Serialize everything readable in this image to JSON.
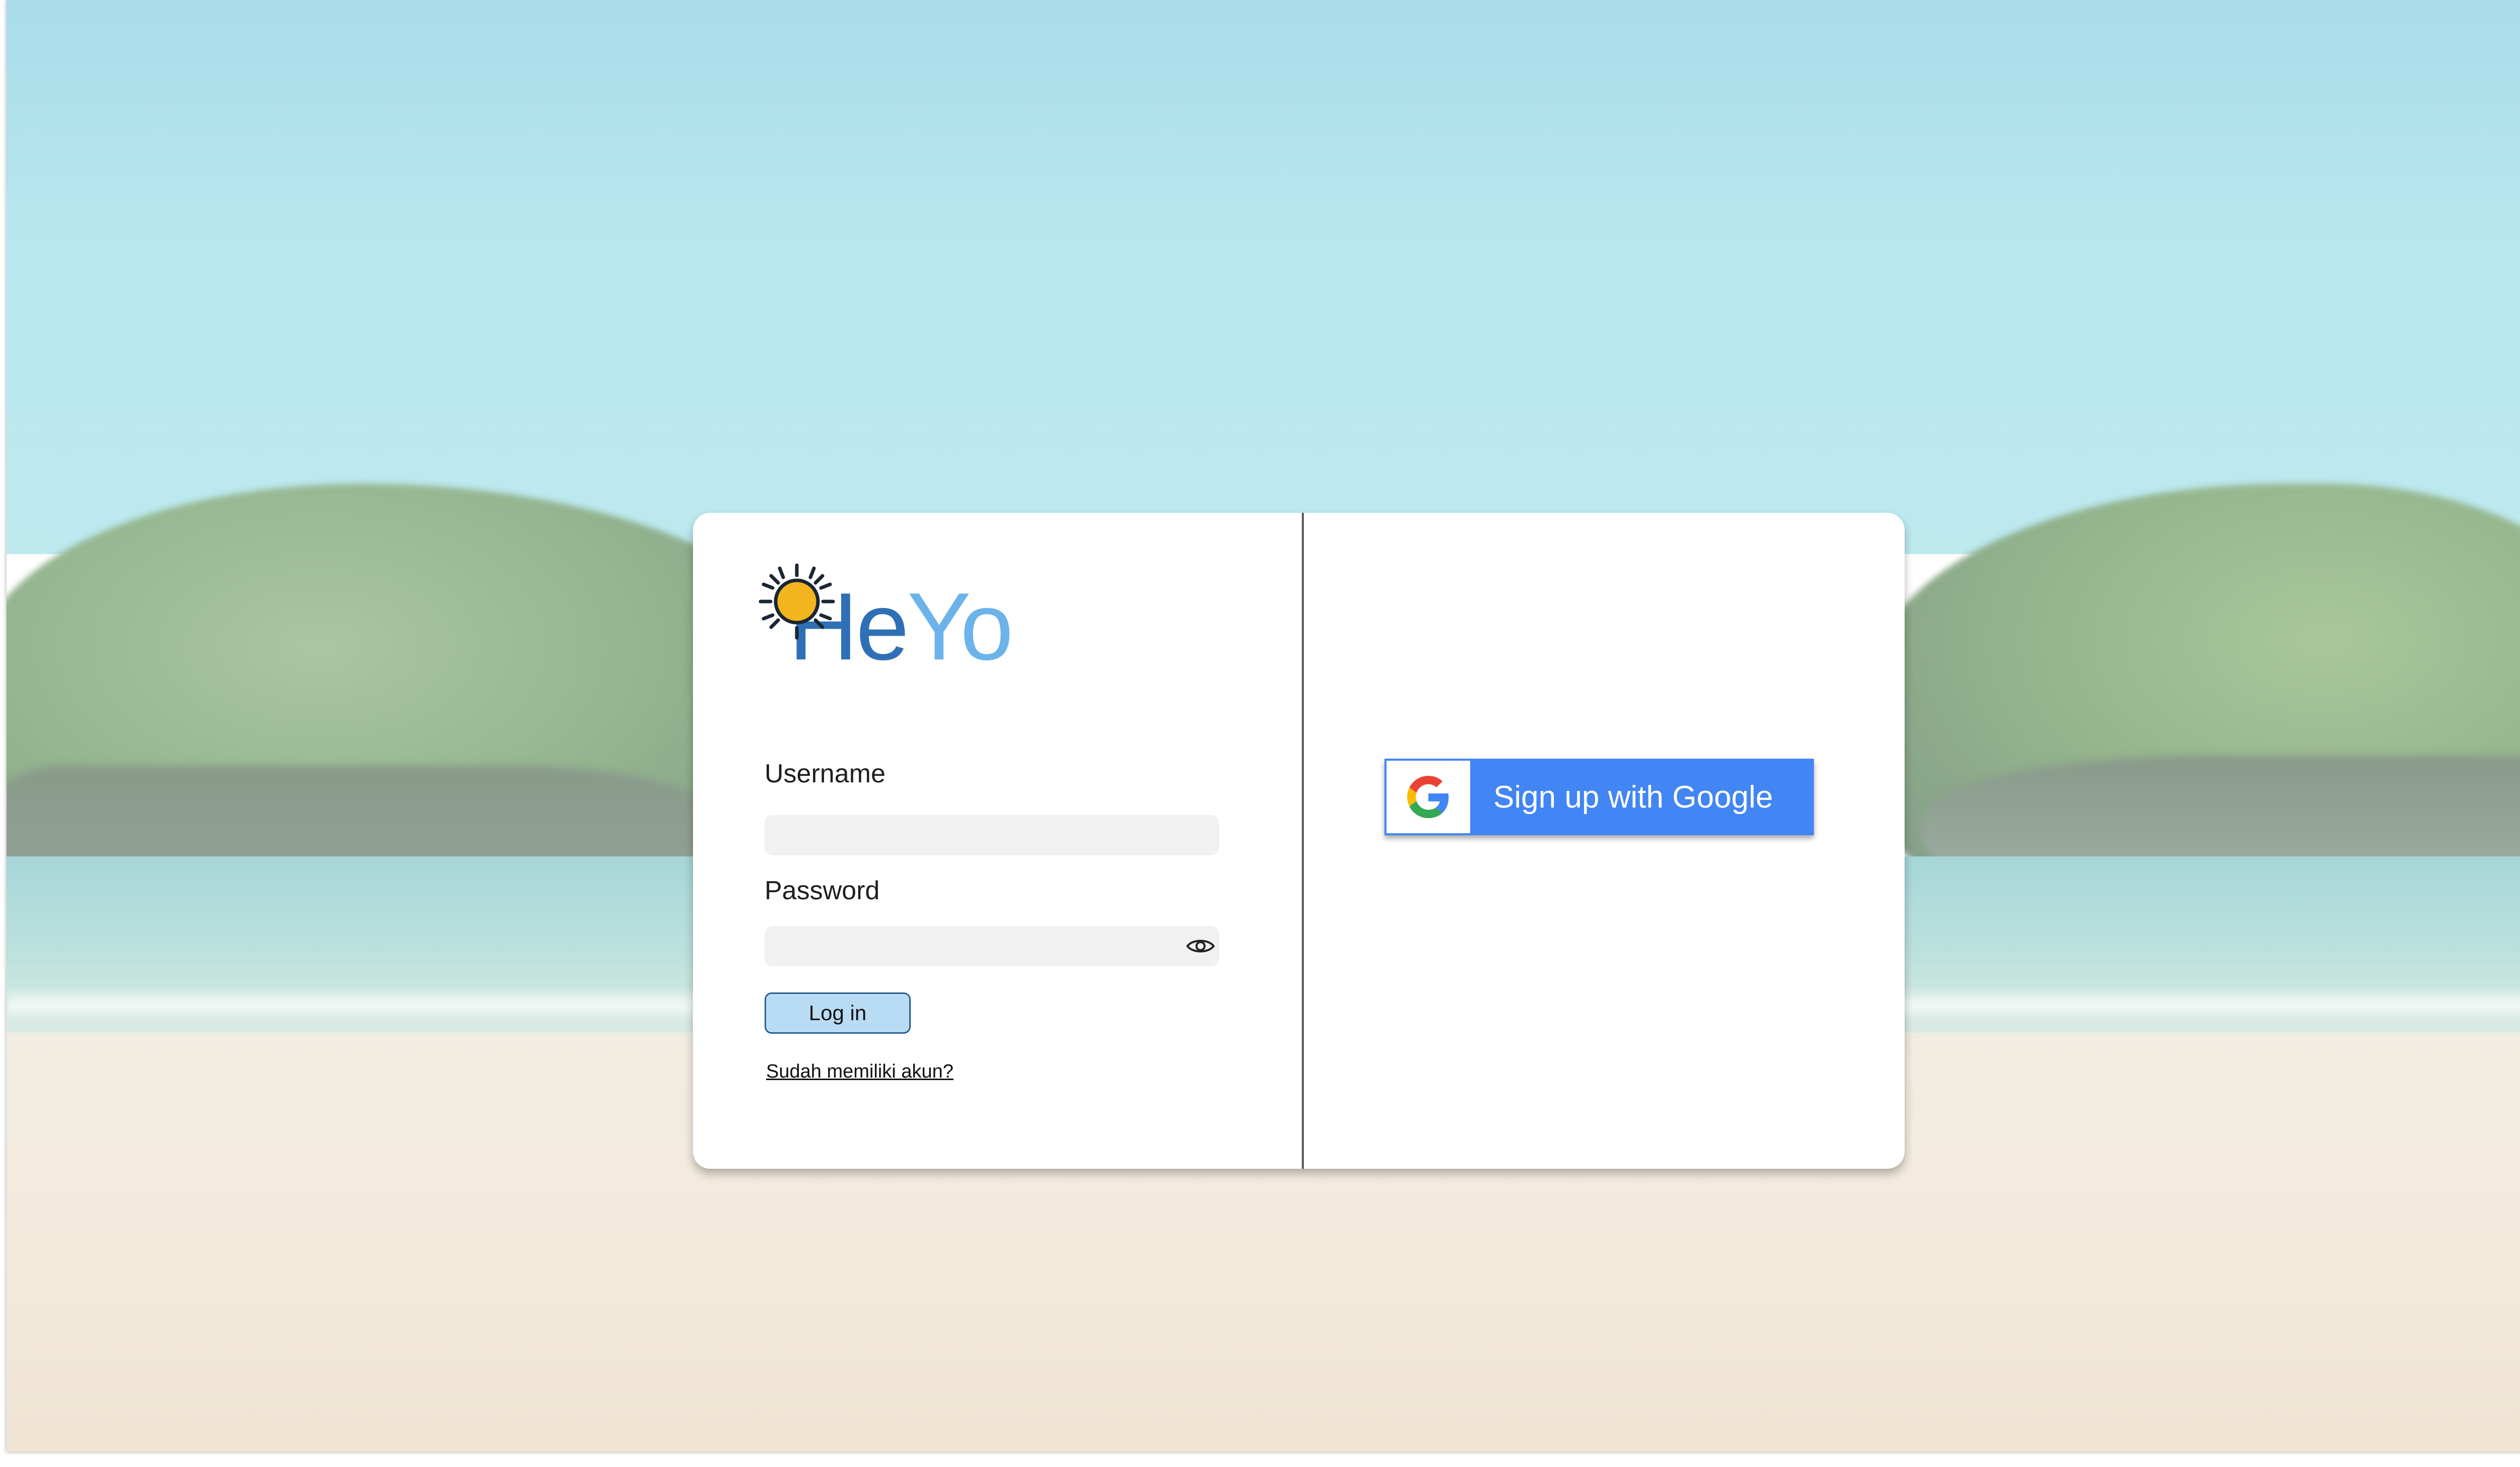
{
  "brand": {
    "logo_text_part1": "He",
    "logo_text_part2": "Yo",
    "logo_icon": "sun-icon",
    "colors": {
      "logo_dark": "#2f6fb6",
      "logo_light": "#6cb3ea",
      "sun": "#f2b51e"
    }
  },
  "login_form": {
    "username_label": "Username",
    "username_value": "",
    "password_label": "Password",
    "password_value": "",
    "password_toggle_icon": "eye-icon",
    "login_button_label": "Log in",
    "account_link_label": "Sudah memiliki akun?"
  },
  "signup": {
    "google_button_label": "Sign up with Google",
    "google_icon": "google-g-icon",
    "button_color": "#4285f4"
  },
  "background": {
    "scene": "beach"
  }
}
